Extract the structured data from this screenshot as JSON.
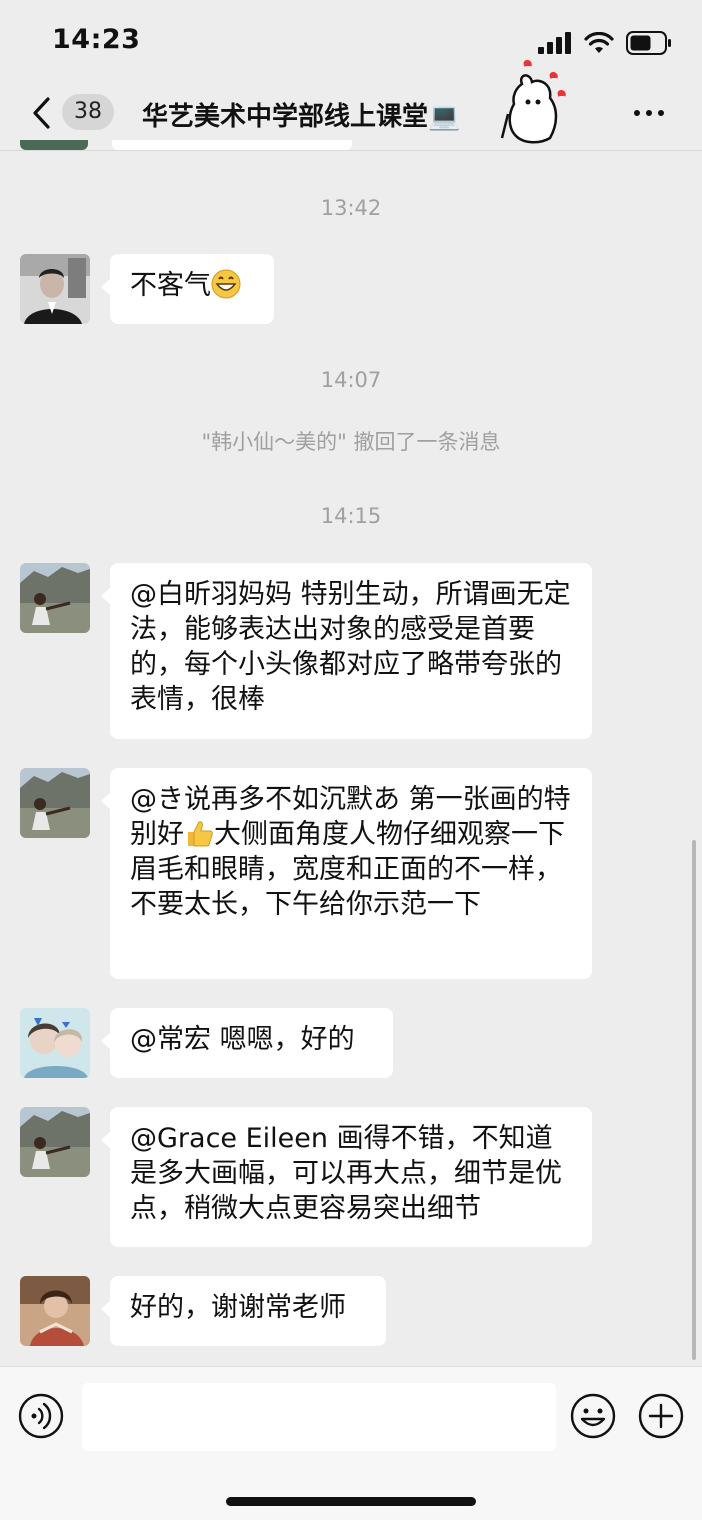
{
  "status_bar": {
    "time": "14:23"
  },
  "nav": {
    "unread_count": "38",
    "title": "华艺美术中学部线上课堂💻"
  },
  "timestamps": [
    "13:42",
    "14:07",
    "14:15"
  ],
  "system_message": "\"韩小仙～美的\" 撤回了一条消息",
  "messages": [
    {
      "sender_avatar": "avatar-man-dark",
      "text": "不客气"
    },
    {
      "sender_avatar": "avatar-teacher",
      "text": "@白昕羽妈妈 特别生动，所谓画无定法，能够表达出对象的感受是首要的，每个小头像都对应了略带夸张的表情，很棒"
    },
    {
      "sender_avatar": "avatar-teacher",
      "text_before": "@き说再多不如沉默あ 第一张画的特别好",
      "text_after": "大侧面角度人物仔细观察一下眉毛和眼睛，宽度和正面的不一样，不要太长，下午给你示范一下"
    },
    {
      "sender_avatar": "avatar-girls",
      "text": "@常宏 嗯嗯，好的"
    },
    {
      "sender_avatar": "avatar-teacher",
      "text": "@Grace Eileen 画得不错，不知道是多大画幅，可以再大点，细节是优点，稍微大点更容易突出细节"
    },
    {
      "sender_avatar": "avatar-woman",
      "text": "好的，谢谢常老师"
    }
  ],
  "icons": {
    "back": "chevron-left-icon",
    "more": "more-dots-icon",
    "voice": "voice-icon",
    "emoji": "emoji-icon",
    "plus": "plus-icon",
    "grin_emoji": "grinning-emoji",
    "thumbs_up": "thumbs-up-emoji"
  },
  "colors": {
    "background": "#ededed",
    "bubble": "#ffffff",
    "system_text": "#a0a0a0"
  }
}
